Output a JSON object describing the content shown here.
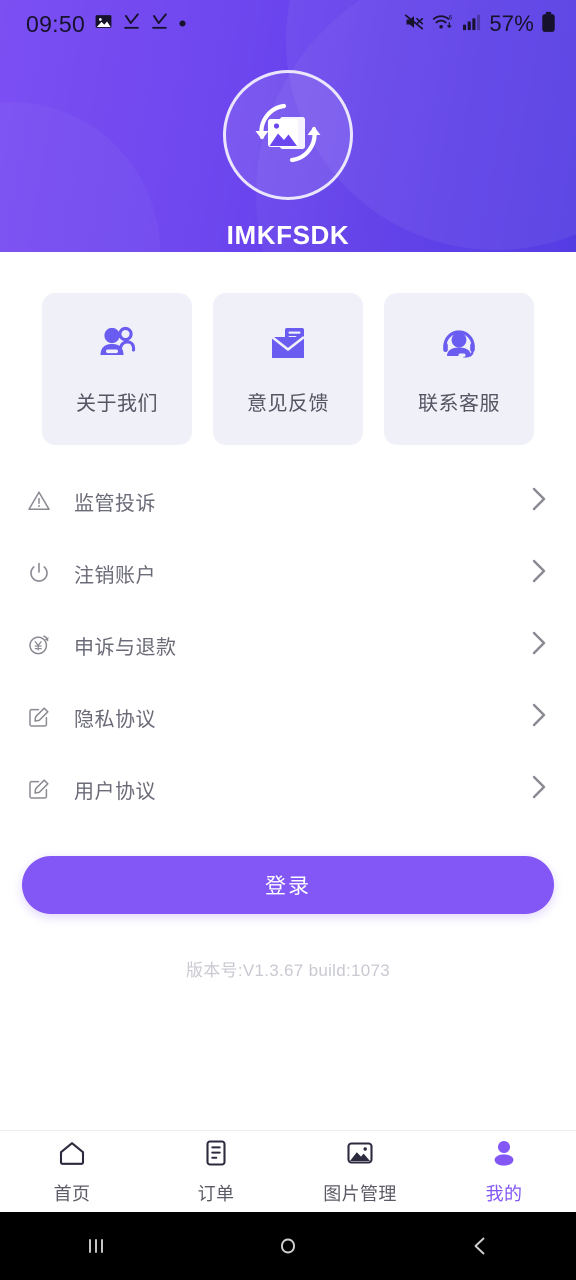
{
  "status_bar": {
    "time": "09:50",
    "battery_percent": "57%",
    "left_icons": [
      "photo-icon",
      "download-complete-icon",
      "download-complete-icon",
      "dot-icon"
    ],
    "right_icons": [
      "mute-icon",
      "wifi-6-icon",
      "cellular-signal-icon",
      "battery-icon"
    ]
  },
  "header": {
    "app_name": "IMKFSDK",
    "logo_icon": "photo-refresh-logo-icon",
    "gradient_start": "#7B4FF2",
    "gradient_end": "#4D34E2"
  },
  "cards": [
    {
      "label": "关于我们",
      "icon": "users-icon"
    },
    {
      "label": "意见反馈",
      "icon": "envelope-icon"
    },
    {
      "label": "联系客服",
      "icon": "headset-icon"
    }
  ],
  "list": [
    {
      "label": "监管投诉",
      "icon": "warning-triangle-icon"
    },
    {
      "label": "注销账户",
      "icon": "power-icon"
    },
    {
      "label": "申诉与退款",
      "icon": "yen-refund-icon"
    },
    {
      "label": "隐私协议",
      "icon": "edit-document-icon"
    },
    {
      "label": "用户协议",
      "icon": "edit-document-icon"
    }
  ],
  "login": {
    "label": "登录",
    "color": "#8257F5"
  },
  "version": "版本号:V1.3.67 build:1073",
  "bottom_nav": {
    "active_color": "#8257F5",
    "items": [
      {
        "label": "首页",
        "icon": "home-icon",
        "active": false
      },
      {
        "label": "订单",
        "icon": "order-list-icon",
        "active": false
      },
      {
        "label": "图片管理",
        "icon": "image-manage-icon",
        "active": false
      },
      {
        "label": "我的",
        "icon": "profile-icon",
        "active": true
      }
    ]
  },
  "android_nav": {
    "recents": "recents-icon",
    "home": "home-circle-icon",
    "back": "back-icon"
  }
}
